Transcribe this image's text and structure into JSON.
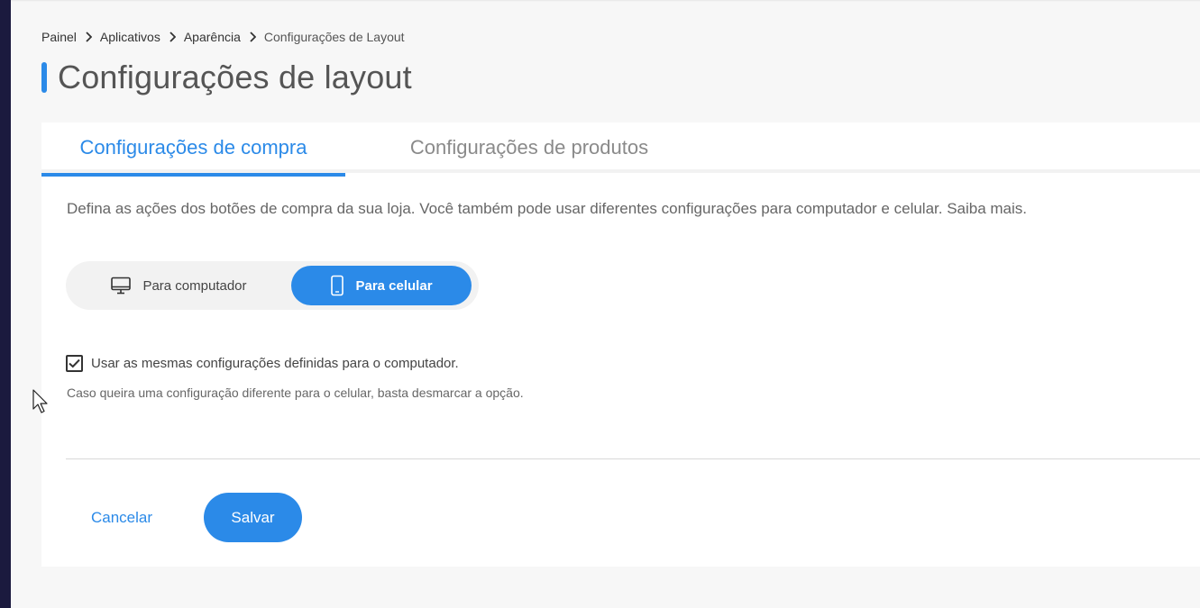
{
  "breadcrumb": {
    "items": [
      "Painel",
      "Aplicativos",
      "Aparência",
      "Configurações de Layout"
    ]
  },
  "page": {
    "title": "Configurações de layout"
  },
  "tabs": [
    {
      "label": "Configurações de compra",
      "active": true
    },
    {
      "label": "Configurações de produtos",
      "active": false
    }
  ],
  "content": {
    "description": "Defina as ações dos botões de compra da sua loja. Você também pode usar diferentes configurações para computador e celular. Saiba mais.",
    "device_toggle": {
      "desktop_label": "Para computador",
      "mobile_label": "Para celular",
      "selected": "mobile"
    },
    "checkbox": {
      "label": "Usar as mesmas configurações definidas para o computador.",
      "checked": true
    },
    "helper_text": "Caso queira uma configuração diferente para o celular, basta desmarcar a opção."
  },
  "actions": {
    "cancel_label": "Cancelar",
    "save_label": "Salvar"
  },
  "colors": {
    "accent": "#2b8ae8",
    "sidebar": "#1b1a3e",
    "background": "#f7f7f7"
  },
  "icons": [
    "chevron-right-icon",
    "desktop-icon",
    "mobile-phone-icon",
    "checkmark-icon",
    "mouse-cursor-icon"
  ]
}
